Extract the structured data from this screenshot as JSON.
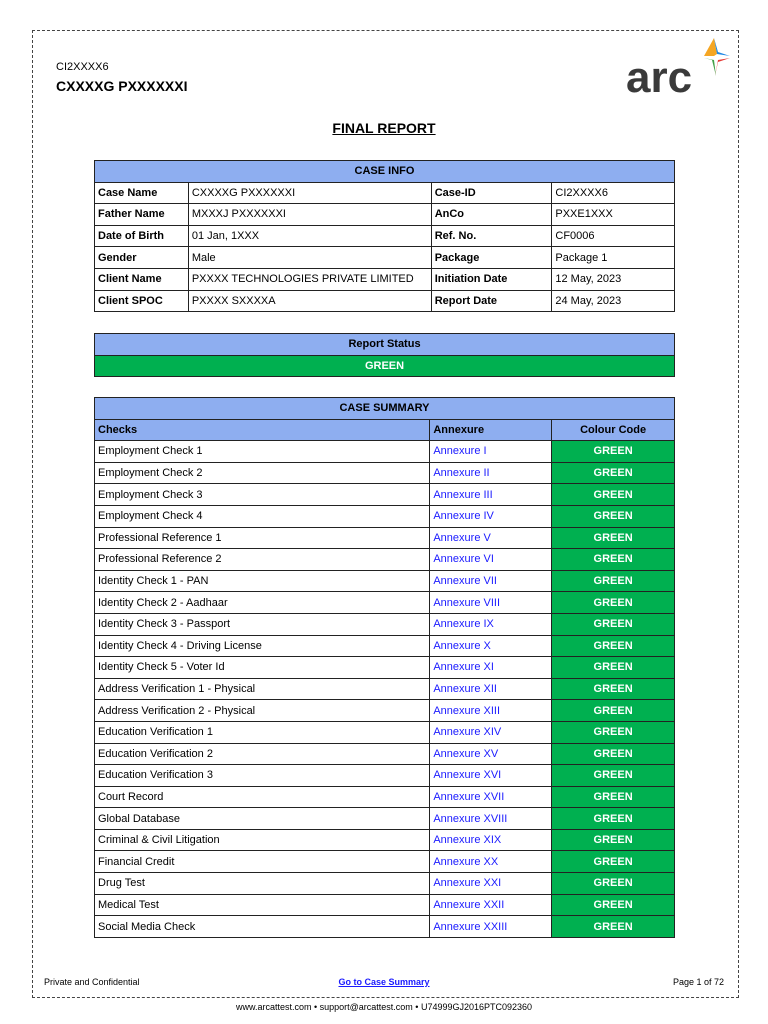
{
  "header": {
    "case_id": "CI2XXXX6",
    "case_name": "CXXXXG PXXXXXXI",
    "logo_text": "arc",
    "title": "FINAL REPORT"
  },
  "case_info": {
    "title": "CASE INFO",
    "rows": [
      [
        "Case Name",
        "CXXXXG PXXXXXXI",
        "Case-ID",
        "CI2XXXX6"
      ],
      [
        "Father Name",
        "MXXXJ PXXXXXXI",
        "AnCo",
        "PXXE1XXX"
      ],
      [
        "Date of Birth",
        "01 Jan, 1XXX",
        "Ref. No.",
        "CF0006"
      ],
      [
        "Gender",
        "Male",
        "Package",
        "Package 1"
      ],
      [
        "Client Name",
        "PXXXX TECHNOLOGIES PRIVATE LIMITED",
        "Initiation Date",
        "12 May, 2023"
      ],
      [
        "Client SPOC",
        "PXXXX SXXXXA",
        "Report Date",
        "24 May, 2023"
      ]
    ]
  },
  "report_status": {
    "title": "Report Status",
    "value": "GREEN"
  },
  "case_summary": {
    "title": "CASE SUMMARY",
    "columns": [
      "Checks",
      "Annexure",
      "Colour Code"
    ],
    "rows": [
      [
        "Employment Check 1",
        "Annexure I",
        "GREEN"
      ],
      [
        "Employment Check 2",
        "Annexure II",
        "GREEN"
      ],
      [
        "Employment Check 3",
        "Annexure III",
        "GREEN"
      ],
      [
        "Employment Check 4",
        "Annexure IV",
        "GREEN"
      ],
      [
        "Professional Reference 1",
        "Annexure V",
        "GREEN"
      ],
      [
        "Professional Reference 2",
        "Annexure VI",
        "GREEN"
      ],
      [
        "Identity Check 1 - PAN",
        "Annexure VII",
        "GREEN"
      ],
      [
        "Identity Check 2 - Aadhaar",
        "Annexure VIII",
        "GREEN"
      ],
      [
        "Identity Check 3 - Passport",
        "Annexure IX",
        "GREEN"
      ],
      [
        "Identity Check 4 - Driving License",
        "Annexure X",
        "GREEN"
      ],
      [
        "Identity Check 5 - Voter Id",
        "Annexure XI",
        "GREEN"
      ],
      [
        "Address Verification 1 - Physical",
        "Annexure XII",
        "GREEN"
      ],
      [
        "Address Verification 2 - Physical",
        "Annexure XIII",
        "GREEN"
      ],
      [
        "Education Verification 1",
        "Annexure XIV",
        "GREEN"
      ],
      [
        "Education Verification 2",
        "Annexure XV",
        "GREEN"
      ],
      [
        "Education Verification 3",
        "Annexure XVI",
        "GREEN"
      ],
      [
        "Court Record",
        "Annexure XVII",
        "GREEN"
      ],
      [
        "Global Database",
        "Annexure XVIII",
        "GREEN"
      ],
      [
        "Criminal & Civil Litigation",
        "Annexure XIX",
        "GREEN"
      ],
      [
        "Financial Credit",
        "Annexure XX",
        "GREEN"
      ],
      [
        "Drug Test",
        "Annexure XXI",
        "GREEN"
      ],
      [
        "Medical Test",
        "Annexure XXII",
        "GREEN"
      ],
      [
        "Social Media Check",
        "Annexure XXIII",
        "GREEN"
      ]
    ]
  },
  "footer": {
    "left": "Private and Confidential",
    "link": "Go to Case Summary",
    "page": "Page 1 of 72",
    "bottom": "www.arcattest.com  •  support@arcattest.com  •  U74999GJ2016PTC092360"
  },
  "colors": {
    "header_blue": "#8eaef0",
    "green": "#00b050",
    "link": "#1a1aff"
  }
}
